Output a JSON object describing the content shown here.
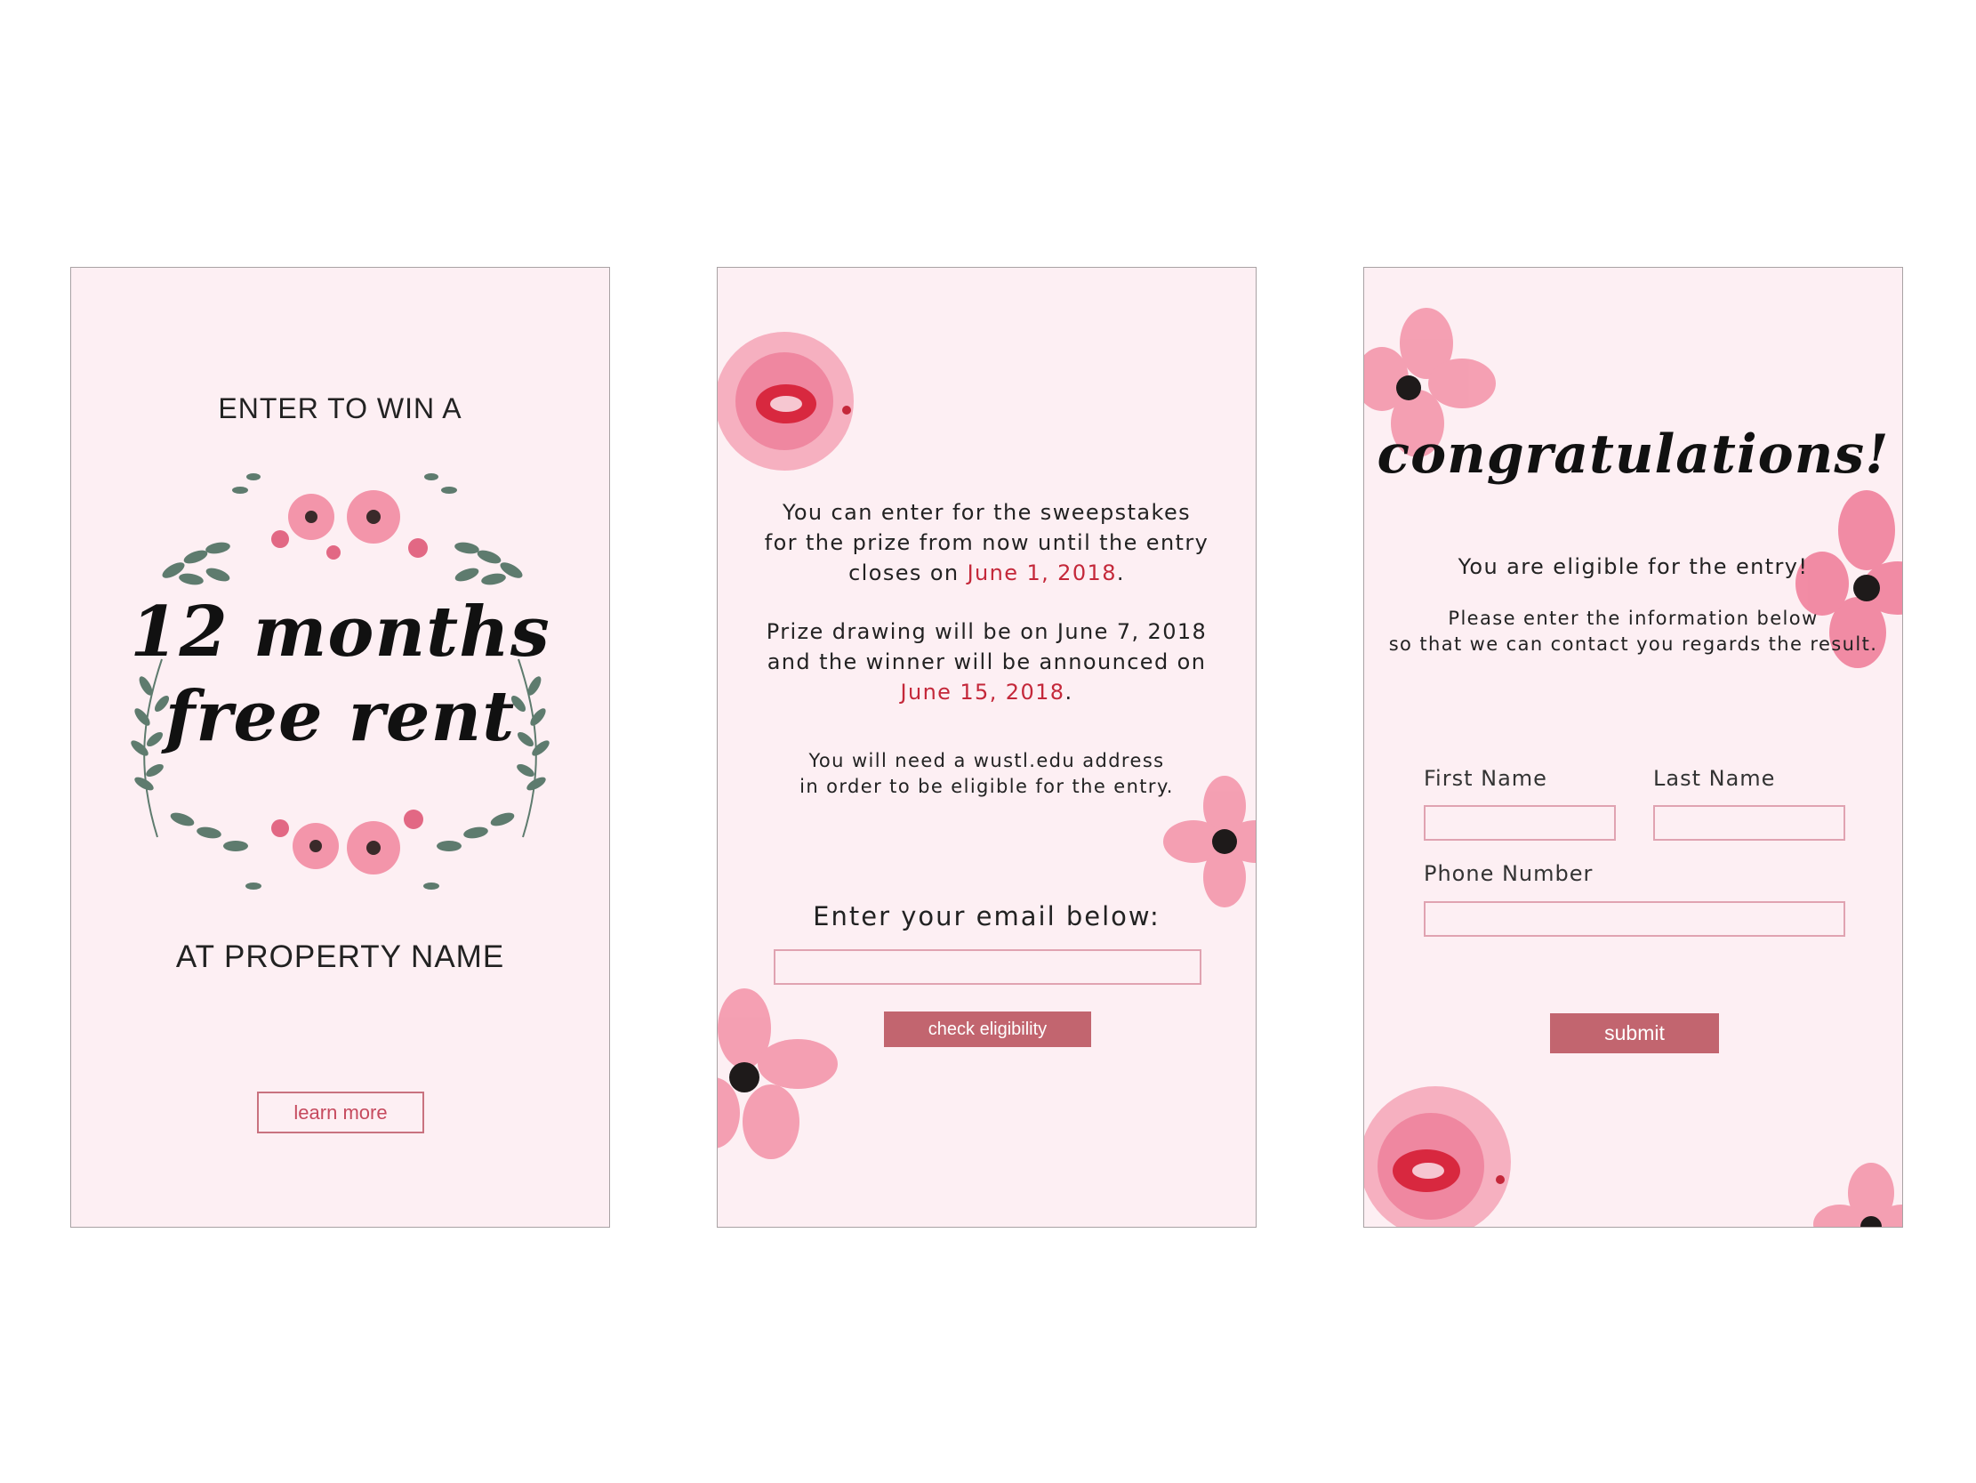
{
  "card1": {
    "heading": "ENTER TO WIN A",
    "title_line1": "12 months",
    "title_line2": "free rent",
    "subheading": "AT  PROPERTY NAME",
    "learn_more_label": "learn more"
  },
  "card2": {
    "p1_line1": "You can enter for the sweepstakes",
    "p1_line2": "for the prize from now until the entry",
    "p1_line3_prefix": "closes on ",
    "p1_line3_date": "June 1, 2018",
    "p1_line3_suffix": ".",
    "p2_line1": "Prize drawing will be on June 7, 2018",
    "p2_line2": "and the winner will be announced on",
    "p2_line3_date": "June 15, 2018",
    "p2_line3_suffix": ".",
    "p3_line1": "You will need a wustl.edu address",
    "p3_line2": "in order to be eligible for the entry.",
    "email_prompt": "Enter your email below:",
    "email_value": "",
    "check_label": "check eligibility"
  },
  "card3": {
    "title": "congratulations!",
    "eligible_text": "You are eligible for the entry!",
    "info_line1": "Please enter the information below",
    "info_line2": "so that we can contact you regards the result.",
    "first_name_label": "First Name",
    "last_name_label": "Last Name",
    "phone_label": "Phone Number",
    "first_name_value": "",
    "last_name_value": "",
    "phone_value": "",
    "submit_label": "submit"
  },
  "colors": {
    "card_bg": "#fdeff3",
    "accent_red": "#c4283a",
    "button_fill": "#c2656f",
    "outline": "#c9727f",
    "leaf_green": "#5e7b6e",
    "petal_pink": "#f28ca3"
  }
}
